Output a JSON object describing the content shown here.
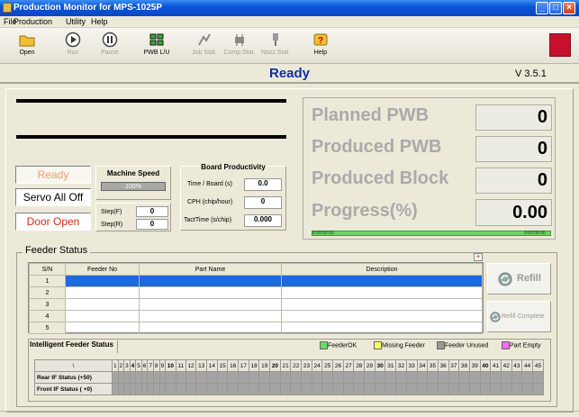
{
  "window": {
    "title": "Production Monitor for MPS-1025P"
  },
  "menu": [
    "File",
    "Production",
    "Utility",
    "Help"
  ],
  "toolbar": {
    "open": "Open",
    "run": "Run",
    "pause": "Pause",
    "pwb": "PWB L/U",
    "job": "Job Stat.",
    "comp": "Comp.Stat.",
    "nozz": "Nozz.Stat.",
    "help": "Help"
  },
  "status": {
    "text": "Ready",
    "version": "V 3.5.1"
  },
  "states": {
    "ready": "Ready",
    "servo": "Servo All Off",
    "door": "Door Open"
  },
  "speed": {
    "title": "Machine Speed",
    "value": "100%"
  },
  "step": {
    "front_label": "Step(F)",
    "front": "0",
    "rear_label": "Step(R)",
    "rear": "0"
  },
  "productivity": {
    "title": "Board Productivity",
    "time_label": "Time / Board (s)",
    "time": "0.0",
    "cph_label": "CPH (chip/hour)",
    "cph": "0",
    "tact_label": "TactTime (s/chip)",
    "tact": "0.000"
  },
  "counters": {
    "planned_label": "Planned PWB",
    "planned": "0",
    "produced_label": "Produced PWB",
    "produced": "0",
    "block_label": "Produced Block",
    "block": "0",
    "progress_label": "Progress(%)",
    "progress": "0.00",
    "time_left": "0:00:00:00",
    "time_right": "0:00:00:00"
  },
  "feeder": {
    "title": "Feeder Status",
    "cols": [
      "S/N",
      "Feeder No",
      "Part Name",
      "Description"
    ],
    "rows": [
      "1",
      "2",
      "3",
      "4",
      "5"
    ],
    "refill": "Refill",
    "refill_complete": "Refill Complete"
  },
  "intelligent": {
    "title": "Intelligent Feeder Status",
    "legend": [
      {
        "label": "FeederOK",
        "color": "#66dd66"
      },
      {
        "label": "Missing Feeder",
        "color": "#ffff66"
      },
      {
        "label": "Feeder Unused",
        "color": "#999999"
      },
      {
        "label": "Part Empty",
        "color": "#ff66ff"
      }
    ],
    "corner": "\\",
    "rear": "Rear IF Status (+50)",
    "front": "Front IF Status ( +0)"
  }
}
